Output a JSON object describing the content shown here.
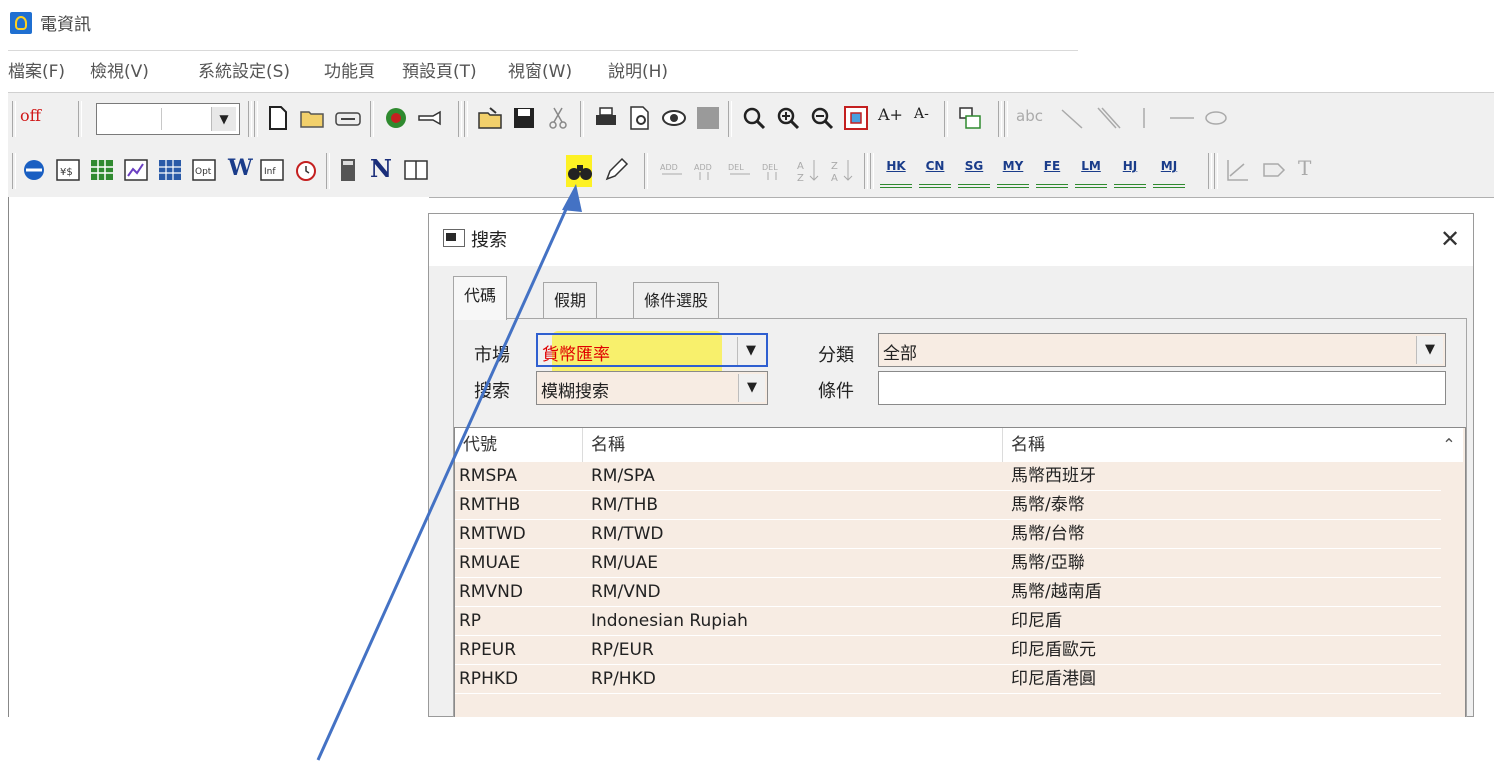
{
  "window": {
    "title": "電資訊"
  },
  "menu": {
    "items": [
      "檔案(F)",
      "檢視(V)",
      "系統設定(S)",
      "功能頁",
      "預設頁(T)",
      "視窗(W)",
      "說明(H)"
    ]
  },
  "toolbar1": {
    "off_label": "off",
    "combo_value": "",
    "text_size_up": "A+",
    "text_size_down": "A-",
    "abc_label": "abc"
  },
  "toolbar2": {
    "n_label": "N",
    "w_label": "W",
    "t_label": "T",
    "markets": [
      "HK",
      "CN",
      "SG",
      "MY",
      "FE",
      "LM",
      "HJ",
      "MJ"
    ]
  },
  "dialog": {
    "title": "搜索",
    "tabs": [
      "代碼",
      "假期",
      "條件選股"
    ],
    "market_label": "市場",
    "market_value": "貨幣匯率",
    "category_label": "分類",
    "category_value": "全部",
    "search_label": "搜索",
    "search_value": "模糊搜索",
    "condition_label": "條件",
    "condition_value": "",
    "table": {
      "headers": [
        "代號",
        "名稱",
        "名稱"
      ],
      "rows": [
        {
          "code": "RMSPA",
          "name": "RM/SPA",
          "name_zh": "馬幣西班牙"
        },
        {
          "code": "RMTHB",
          "name": "RM/THB",
          "name_zh": "馬幣/泰幣"
        },
        {
          "code": "RMTWD",
          "name": "RM/TWD",
          "name_zh": "馬幣/台幣"
        },
        {
          "code": "RMUAE",
          "name": "RM/UAE",
          "name_zh": "馬幣/亞聯"
        },
        {
          "code": "RMVND",
          "name": "RM/VND",
          "name_zh": "馬幣/越南盾"
        },
        {
          "code": "RP",
          "name": "Indonesian Rupiah",
          "name_zh": "印尼盾"
        },
        {
          "code": "RPEUR",
          "name": "RP/EUR",
          "name_zh": "印尼盾歐元"
        },
        {
          "code": "RPHKD",
          "name": "RP/HKD",
          "name_zh": "印尼盾港圓"
        }
      ]
    }
  },
  "colors": {
    "highlight": "#fff100",
    "arrow": "#4472c4",
    "market_text": "#e00000",
    "row_bg": "#f7ece3"
  }
}
